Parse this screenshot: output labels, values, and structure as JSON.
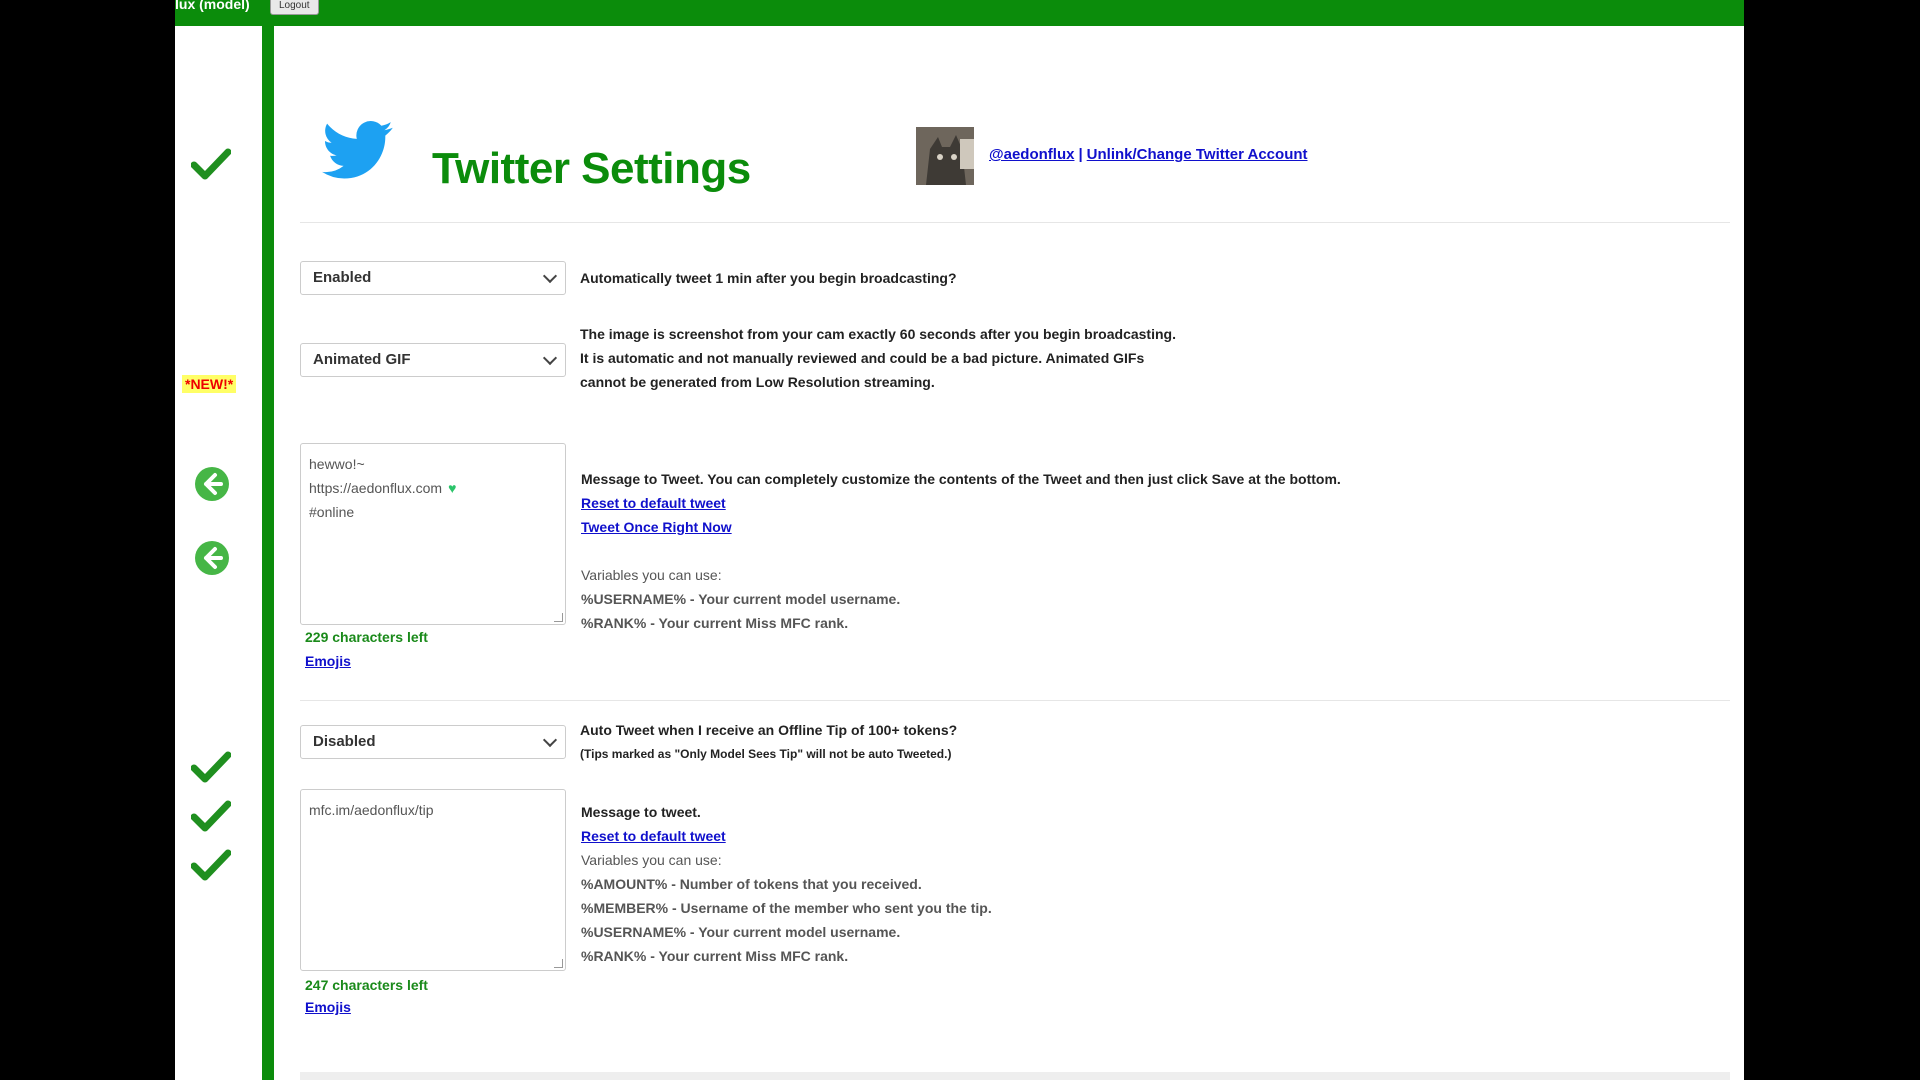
{
  "topbar": {
    "user": "lux (model)",
    "logout": "Logout"
  },
  "sidebar": {
    "new_badge": "*NEW!*"
  },
  "header": {
    "title": "Twitter Settings",
    "handle": "@aedonflux",
    "separator": "|",
    "change_account": "Unlink/Change Twitter Account"
  },
  "broadcast": {
    "select_value": "Enabled",
    "question": "Automatically tweet 1 min after you begin broadcasting?"
  },
  "image": {
    "select_value": "Animated GIF",
    "desc_line1": "The image is screenshot from your cam exactly 60 seconds after you begin broadcasting.",
    "desc_line2": "It is automatic and not manually reviewed and could be a bad picture. Animated GIFs",
    "desc_line3": "cannot be generated from Low Resolution streaming."
  },
  "tweet_message": {
    "line1": "hewwo!~",
    "line2": "https://aedonflux.com",
    "line3": "#online",
    "chars_left": "229 characters left",
    "emojis": "Emojis",
    "info": "Message to Tweet. You can completely customize the contents of the Tweet and then just click Save at the bottom.",
    "reset": "Reset to default tweet",
    "tweet_now": "Tweet Once Right Now",
    "vars_title": "Variables you can use:",
    "var1": "%USERNAME% - Your current model username.",
    "var2": "%RANK% - Your current Miss MFC rank."
  },
  "offline_tip": {
    "select_value": "Disabled",
    "question": "Auto Tweet when I receive an Offline Tip of 100+ tokens?",
    "note": "(Tips marked as \"Only Model Sees Tip\" will not be auto Tweeted.)",
    "message": "mfc.im/aedonflux/tip",
    "chars_left": "247 characters left",
    "emojis": "Emojis",
    "info": "Message to tweet.",
    "reset": "Reset to default tweet",
    "vars_title": "Variables you can use:",
    "var1": "%AMOUNT% - Number of tokens that you received.",
    "var2": "%MEMBER% - Username of the member who sent you the tip.",
    "var3": "%USERNAME% - Your current model username.",
    "var4": "%RANK% - Your current Miss MFC rank."
  },
  "colors": {
    "brand_green": "#0b8c0b",
    "link_blue": "#1010cc",
    "twitter_blue": "#1da1f2"
  }
}
